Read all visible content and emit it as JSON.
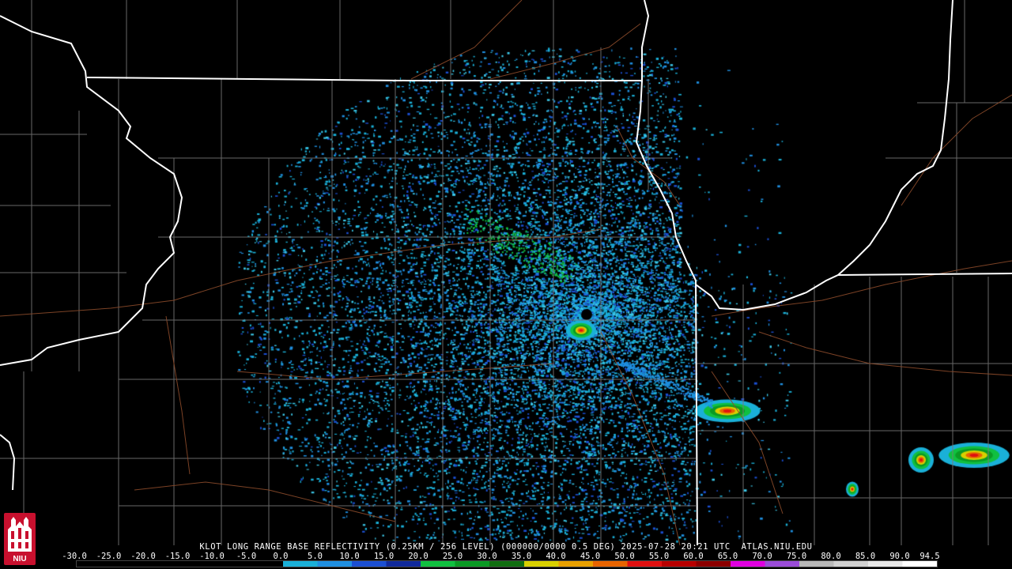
{
  "caption": "KLOT LONG RANGE BASE REFLECTIVITY (0.25KM / 256 LEVEL) (000000/0000 0.5 DEG) 2025-07-28 20:21 UTC  ATLAS.NIU.EDU",
  "scale": {
    "labels": [
      "-30.0",
      "-25.0",
      "-20.0",
      "-15.0",
      "-10.0",
      "-5.0",
      "0.0",
      "5.0",
      "10.0",
      "15.0",
      "20.0",
      "25.0",
      "30.0",
      "35.0",
      "40.0",
      "45.0",
      "50.0",
      "55.0",
      "60.0",
      "65.0",
      "70.0",
      "75.0",
      "80.0",
      "85.0",
      "90.0",
      "94.5"
    ],
    "colors": [
      "#000000",
      "#000000",
      "#000000",
      "#000000",
      "#000000",
      "#000000",
      "#1ab0d8",
      "#1f8fe0",
      "#1b4fd2",
      "#102a9c",
      "#10c040",
      "#0a9a24",
      "#106e10",
      "#d8d000",
      "#e8a000",
      "#e86400",
      "#e01010",
      "#b80000",
      "#8c0000",
      "#e000e0",
      "#9a4cd8",
      "#b8b8b8",
      "#d0d0d0",
      "#e8e8e8",
      "#ffffff",
      "#ffffff"
    ]
  },
  "colors": {
    "state_border": "#ffffff",
    "county_border": "#7a7a7a",
    "highway": "#8a4a2a",
    "background": "#000000"
  },
  "logo": {
    "text": "NIU",
    "icon": "niu-castle-logo"
  }
}
